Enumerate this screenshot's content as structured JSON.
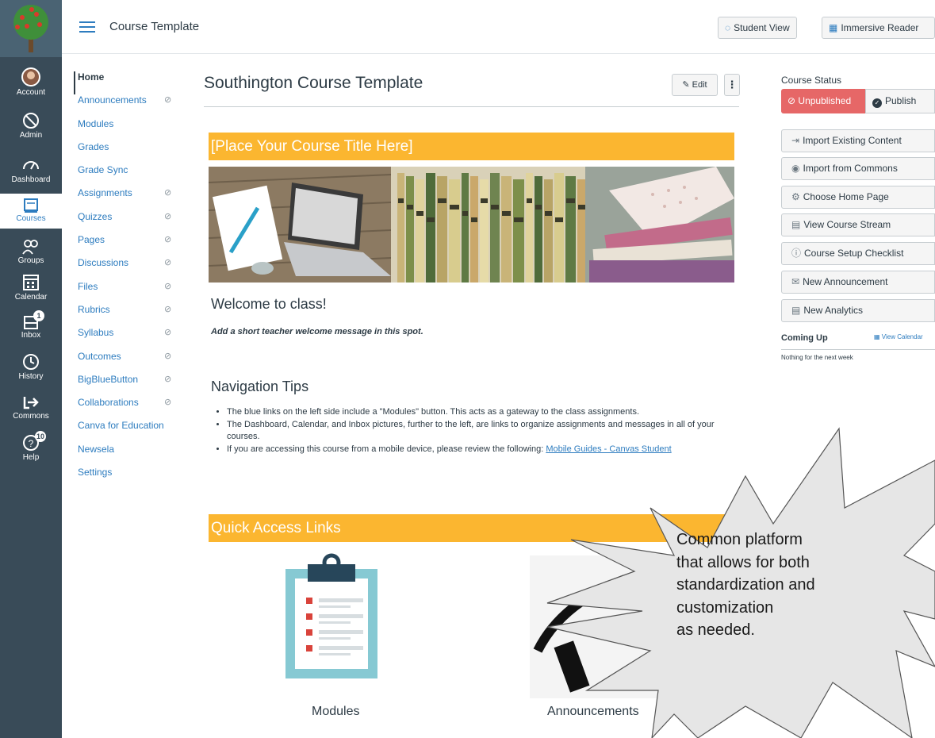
{
  "global_nav": {
    "items": [
      {
        "label": "Account",
        "icon": "avatar-icon"
      },
      {
        "label": "Admin",
        "icon": "shield-icon"
      },
      {
        "label": "Dashboard",
        "icon": "dashboard-icon"
      },
      {
        "label": "Courses",
        "icon": "book-icon"
      },
      {
        "label": "Groups",
        "icon": "people-icon"
      },
      {
        "label": "Calendar",
        "icon": "calendar-icon"
      },
      {
        "label": "Inbox",
        "icon": "inbox-icon",
        "badge": "1"
      },
      {
        "label": "History",
        "icon": "clock-icon"
      },
      {
        "label": "Commons",
        "icon": "share-arrow-icon"
      },
      {
        "label": "Help",
        "icon": "help-icon",
        "badge": "10"
      }
    ],
    "active": "Courses"
  },
  "header": {
    "breadcrumb": "Course Template",
    "student_view_label": "Student View",
    "immersive_reader_label": "Immersive Reader"
  },
  "course_nav": {
    "items": [
      {
        "label": "Home",
        "hidden": false
      },
      {
        "label": "Announcements",
        "hidden": true
      },
      {
        "label": "Modules",
        "hidden": false
      },
      {
        "label": "Grades",
        "hidden": false
      },
      {
        "label": "Grade Sync",
        "hidden": false
      },
      {
        "label": "Assignments",
        "hidden": true
      },
      {
        "label": "Quizzes",
        "hidden": true
      },
      {
        "label": "Pages",
        "hidden": true
      },
      {
        "label": "Discussions",
        "hidden": true
      },
      {
        "label": "Files",
        "hidden": true
      },
      {
        "label": "Rubrics",
        "hidden": true
      },
      {
        "label": "Syllabus",
        "hidden": true
      },
      {
        "label": "Outcomes",
        "hidden": true
      },
      {
        "label": "BigBlueButton",
        "hidden": true
      },
      {
        "label": "Collaborations",
        "hidden": true
      },
      {
        "label": "Canva for Education",
        "hidden": false
      },
      {
        "label": "Newsela",
        "hidden": false
      },
      {
        "label": "Settings",
        "hidden": false
      }
    ]
  },
  "main": {
    "title": "Southington Course Template",
    "edit_label": "Edit",
    "more_label": "⋮",
    "course_title_banner": "[Place Your Course Title Here]",
    "welcome_heading": "Welcome to class!",
    "welcome_message": "Add a short teacher welcome message in this spot.",
    "nav_tips_heading": "Navigation Tips",
    "tips": [
      "The blue links on the left side include a \"Modules\" button.  This acts as a gateway to the class assignments.",
      "The Dashboard, Calendar, and Inbox pictures, further to the left, are links to organize assignments and messages in all of your courses.",
      "If you are accessing this course from a mobile device, please review the following: "
    ],
    "mobile_link": "Mobile Guides - Canvas Student",
    "quick_links_banner": "Quick Access Links",
    "tiles": [
      {
        "label": "Modules"
      },
      {
        "label": "Announcements"
      }
    ]
  },
  "sidebar": {
    "course_status_label": "Course Status",
    "unpublished_label": "Unpublished",
    "publish_label": "Publish",
    "buttons": [
      "Import Existing Content",
      "Import from Commons",
      "Choose Home Page",
      "View Course Stream",
      "Course Setup Checklist",
      "New Announcement",
      "New Analytics"
    ],
    "coming_up_label": "Coming Up",
    "view_calendar_label": "View Calendar",
    "nothing_label": "Nothing for the next week"
  },
  "callout": {
    "lines": [
      "Common platform",
      "that allows for both",
      "standardization and",
      "customization",
      "as needed."
    ]
  },
  "colors": {
    "nav_bg": "#394b58",
    "link": "#2d7cbf",
    "banner": "#fbb630",
    "unpublished": "#e66767"
  }
}
